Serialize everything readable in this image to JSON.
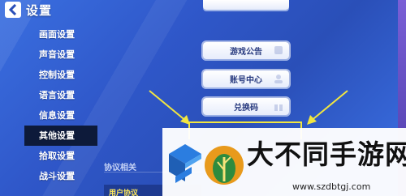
{
  "header": {
    "title": "设置"
  },
  "sidebar": {
    "items": [
      {
        "label": "画面设置"
      },
      {
        "label": "声音设置"
      },
      {
        "label": "控制设置"
      },
      {
        "label": "语言设置"
      },
      {
        "label": "信息设置"
      },
      {
        "label": "其他设置"
      },
      {
        "label": "拾取设置"
      },
      {
        "label": "战斗设置"
      }
    ],
    "active_index": 5
  },
  "main": {
    "buttons": [
      {
        "label": "游戏公告",
        "icon": "announcement-icon"
      },
      {
        "label": "账号中心",
        "icon": "account-icon"
      },
      {
        "label": "兑换码",
        "icon": "gift-icon"
      }
    ],
    "section_label": "协议相关",
    "agreement_label": "用户协议"
  },
  "watermark": {
    "name": "大不同手游网",
    "url": "www.szdbtgj.com"
  },
  "colors": {
    "background": "#2f57c9",
    "active_item": "#0d1a3a",
    "highlight": "#f2e640",
    "button_text": "#2a3c80"
  }
}
